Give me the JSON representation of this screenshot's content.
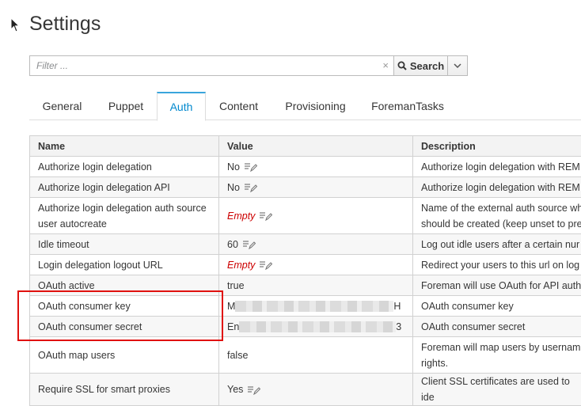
{
  "page": {
    "title": "Settings"
  },
  "search": {
    "placeholder": "Filter ...",
    "clear_label": "×",
    "button_label": "Search"
  },
  "tabs": [
    {
      "label": "General"
    },
    {
      "label": "Puppet"
    },
    {
      "label": "Auth"
    },
    {
      "label": "Content"
    },
    {
      "label": "Provisioning"
    },
    {
      "label": "ForemanTasks"
    }
  ],
  "active_tab": "Auth",
  "table": {
    "headers": {
      "name": "Name",
      "value": "Value",
      "description": "Description"
    },
    "rows": [
      {
        "name": "Authorize login delegation",
        "value": "No",
        "description": "Authorize login delegation with REM"
      },
      {
        "name": "Authorize login delegation API",
        "value": "No",
        "description": "Authorize login delegation with REM"
      },
      {
        "name": "Authorize login delegation auth source user autocreate",
        "value": "Empty",
        "description": "Name of the external auth source wh should be created (keep unset to pre"
      },
      {
        "name": "Idle timeout",
        "value": "60",
        "description": "Log out idle users after a certain nur"
      },
      {
        "name": "Login delegation logout URL",
        "value": "Empty",
        "description": "Redirect your users to this url on log"
      },
      {
        "name": "OAuth active",
        "value": "true",
        "description": "Foreman will use OAuth for API auth"
      },
      {
        "name": "OAuth consumer key",
        "value_start": "M",
        "value_end": "H",
        "description": "OAuth consumer key"
      },
      {
        "name": "OAuth consumer secret",
        "value_start": "En",
        "value_end": "3",
        "description": "OAuth consumer secret"
      },
      {
        "name": "OAuth map users",
        "value": "false",
        "description": "Foreman will map users by usernam rights."
      },
      {
        "name": "Require SSL for smart proxies",
        "value": "Yes",
        "description": "Client SSL certificates are used to ide"
      }
    ]
  },
  "colors": {
    "accent": "#0088ce",
    "active_tab_border": "#39a5dc",
    "empty_value": "#cc0000",
    "highlight_box": "#e0110e"
  }
}
